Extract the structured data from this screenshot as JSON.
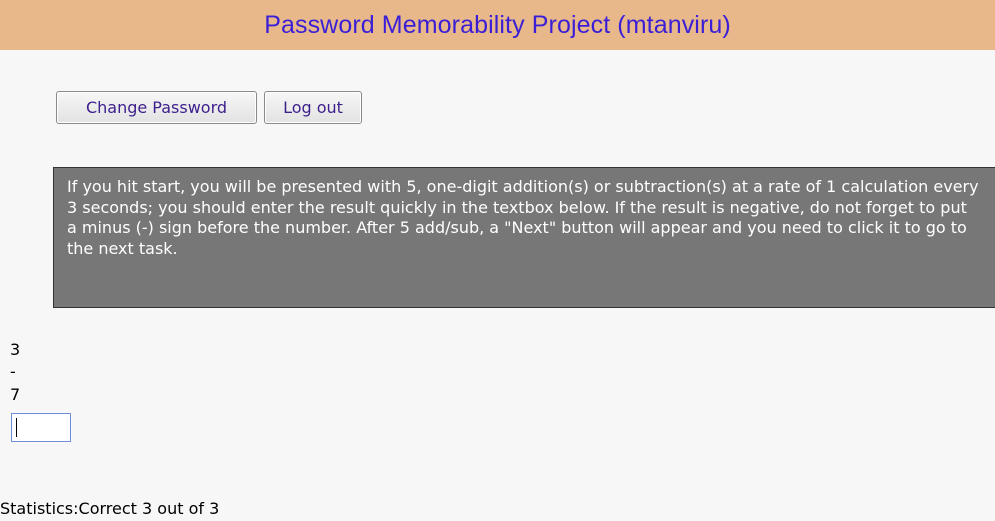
{
  "header": {
    "title": "Password Memorability Project (mtanviru)"
  },
  "actions": {
    "change_password_label": "Change Password",
    "logout_label": "Log out"
  },
  "instructions": {
    "text": "If you hit start, you will be presented with 5, one-digit addition(s) or subtraction(s) at a rate of 1 calculation every 3 seconds; you should enter the result quickly in the textbox below. If the result is negative, do not forget to put a minus (-) sign before the number. After 5 add/sub, a \"Next\" button will appear and you need to click it to go to the next task."
  },
  "calculation": {
    "operand_a": "3",
    "operator": "-",
    "operand_b": "7",
    "answer_value": ""
  },
  "statistics": {
    "label": "Statistics:",
    "text": "Correct 3 out of 3"
  },
  "colors": {
    "header_background": "#e8b88a",
    "header_title": "#3a1fd6",
    "instruction_box": "#777777",
    "button_text": "#3d1f8c",
    "input_border": "#6f8fd8"
  }
}
